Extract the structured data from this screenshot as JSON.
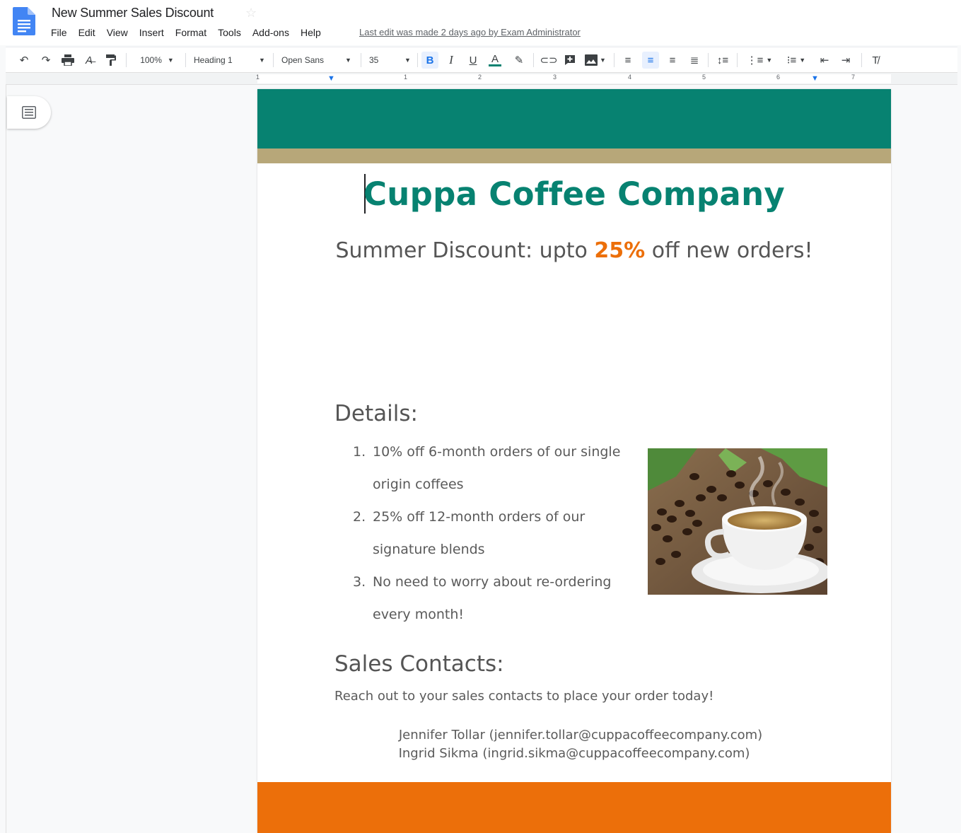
{
  "app": {
    "doc_title": "New Summer Sales Discount",
    "menu": [
      "File",
      "Edit",
      "View",
      "Insert",
      "Format",
      "Tools",
      "Add-ons",
      "Help"
    ],
    "last_edit": "Last edit was made 2 days ago by Exam Administrator"
  },
  "toolbar": {
    "zoom": "100%",
    "style": "Heading 1",
    "font": "Open Sans",
    "size": "35",
    "icons": [
      "undo-icon",
      "redo-icon",
      "print-icon",
      "spellcheck-icon",
      "paint-format-icon",
      "bold-icon",
      "italic-icon",
      "underline-icon",
      "text-color-icon",
      "highlight-icon",
      "link-icon",
      "comment-icon",
      "image-icon",
      "align-left-icon",
      "align-center-icon",
      "align-right-icon",
      "justify-icon",
      "line-spacing-icon",
      "numbered-list-icon",
      "bulleted-list-icon",
      "decrease-indent-icon",
      "increase-indent-icon",
      "clear-formatting-icon"
    ]
  },
  "ruler": {
    "numbers": [
      "1",
      "1",
      "2",
      "3",
      "4",
      "5",
      "6",
      "7"
    ]
  },
  "document": {
    "title": "Cuppa Coffee Company",
    "subtitle_before": "Summer Discount: upto ",
    "subtitle_highlight": "25%",
    "subtitle_after": " off new orders!",
    "details_heading": "Details:",
    "details": [
      {
        "num": "1.",
        "text": "10% off 6-month orders of our single origin coffees"
      },
      {
        "num": "2.",
        "text": "25% off 12-month orders of our signature blends"
      },
      {
        "num": "3.",
        "text": "No need to worry about re-ordering every month!"
      }
    ],
    "contacts_heading": "Sales Contacts:",
    "contacts_text": "Reach out to your sales contacts to place your order today!",
    "contacts": [
      "Jennifer Tollar (jennifer.tollar@cuppacoffeecompany.com)",
      "Ingrid Sikma (ingrid.sikma@cuppacoffeecompany.com)"
    ],
    "image": "coffee-cup-and-beans"
  },
  "colors": {
    "teal": "#078271",
    "gold": "#b7a779",
    "orange": "#ec6f0a",
    "accent_blue": "#1a73e8"
  }
}
